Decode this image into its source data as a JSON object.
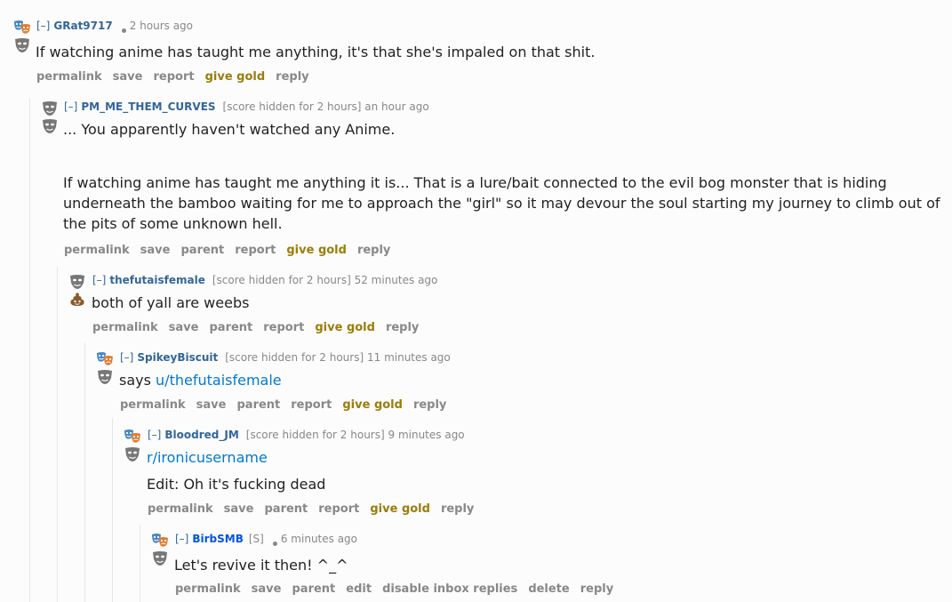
{
  "comments": [
    {
      "collapse": "[–]",
      "author": "GRat9717",
      "score": "",
      "time": "2 hours ago",
      "paragraphs": [
        "If watching anime has taught me anything, it's that she's impaled on that shit."
      ],
      "buttons": [
        "permalink",
        "save",
        "report",
        "give gold",
        "reply"
      ]
    },
    {
      "collapse": "[–]",
      "author": "PM_ME_THEM_CURVES",
      "score": "[score hidden for 2 hours]",
      "time": "an hour ago",
      "paragraphs": [
        "... You apparently haven't watched any Anime.",
        "If watching anime has taught me anything it is... That is a lure/bait connected to the evil bog monster that is hiding underneath the bamboo waiting for me to approach the \"girl\" so it may devour the soul starting my journey to climb out of the pits of some unknown hell."
      ],
      "buttons": [
        "permalink",
        "save",
        "parent",
        "report",
        "give gold",
        "reply"
      ]
    },
    {
      "collapse": "[–]",
      "author": "thefutaisfemale",
      "score": "[score hidden for 2 hours]",
      "time": "52 minutes ago",
      "paragraphs": [
        "both of yall are weebs"
      ],
      "buttons": [
        "permalink",
        "save",
        "parent",
        "report",
        "give gold",
        "reply"
      ]
    },
    {
      "collapse": "[–]",
      "author": "SpikeyBiscuit",
      "score": "[score hidden for 2 hours]",
      "time": "11 minutes ago",
      "says": "says",
      "link": "u/thefutaisfemale",
      "buttons": [
        "permalink",
        "save",
        "parent",
        "report",
        "give gold",
        "reply"
      ]
    },
    {
      "collapse": "[–]",
      "author": "Bloodred_JM",
      "score": "[score hidden for 2 hours]",
      "time": "9 minutes ago",
      "link": "r/ironicusername",
      "paragraphs": [
        "Edit: Oh it's fucking dead"
      ],
      "buttons": [
        "permalink",
        "save",
        "parent",
        "report",
        "give gold",
        "reply"
      ]
    },
    {
      "collapse": "[–]",
      "author": "BirbSMB",
      "submitter": "[S]",
      "time": "6 minutes ago",
      "paragraphs": [
        "Let's revive it then! ^_^"
      ],
      "buttons": [
        "permalink",
        "save",
        "parent",
        "edit",
        "disable inbox replies",
        "delete",
        "reply"
      ]
    }
  ],
  "colors": {
    "author": "#336699",
    "op_author": "#0055df",
    "gold": "#9a7d0a",
    "link": "#0079d3"
  },
  "flair_icons": [
    "drama-masks-icon",
    "gray-mask-icon",
    "poop-icon"
  ]
}
